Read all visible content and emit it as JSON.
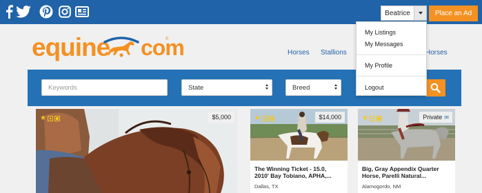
{
  "topbar": {
    "social": [
      {
        "icon": "facebook-icon"
      },
      {
        "icon": "twitter-icon"
      },
      {
        "icon": "pinterest-icon"
      },
      {
        "icon": "instagram-icon"
      },
      {
        "icon": "newsletter-icon"
      }
    ],
    "user_name": "Beatrice",
    "place_ad_label": "Place an Ad"
  },
  "header": {
    "logo_left": "equine",
    "logo_right": "com",
    "nav": [
      "Horses",
      "Stallions",
      "Horses"
    ]
  },
  "search": {
    "keywords_placeholder": "Keywords",
    "state_value": "State",
    "breed_value": "Breed",
    "search_icon": "search-icon"
  },
  "user_menu": {
    "items": [
      "My Listings",
      "My Messages",
      "My Profile",
      "Logout"
    ]
  },
  "listings": [
    {
      "price": "$5,000",
      "title_lines": [],
      "location": ""
    },
    {
      "price": "$14,000",
      "title_lines": [
        "The Winning Ticket - 15.0,",
        "2010' Bay Tobiano, APHA,..."
      ],
      "location": "Dallas, TX"
    },
    {
      "price": "Private",
      "title_lines": [
        "Big, Gray Appendix Quarter",
        "Horse, Parelli Natural..."
      ],
      "location": "Alamogordo, NM"
    }
  ],
  "colors": {
    "brand_blue": "#2063a8",
    "accent_orange": "#f39123"
  }
}
